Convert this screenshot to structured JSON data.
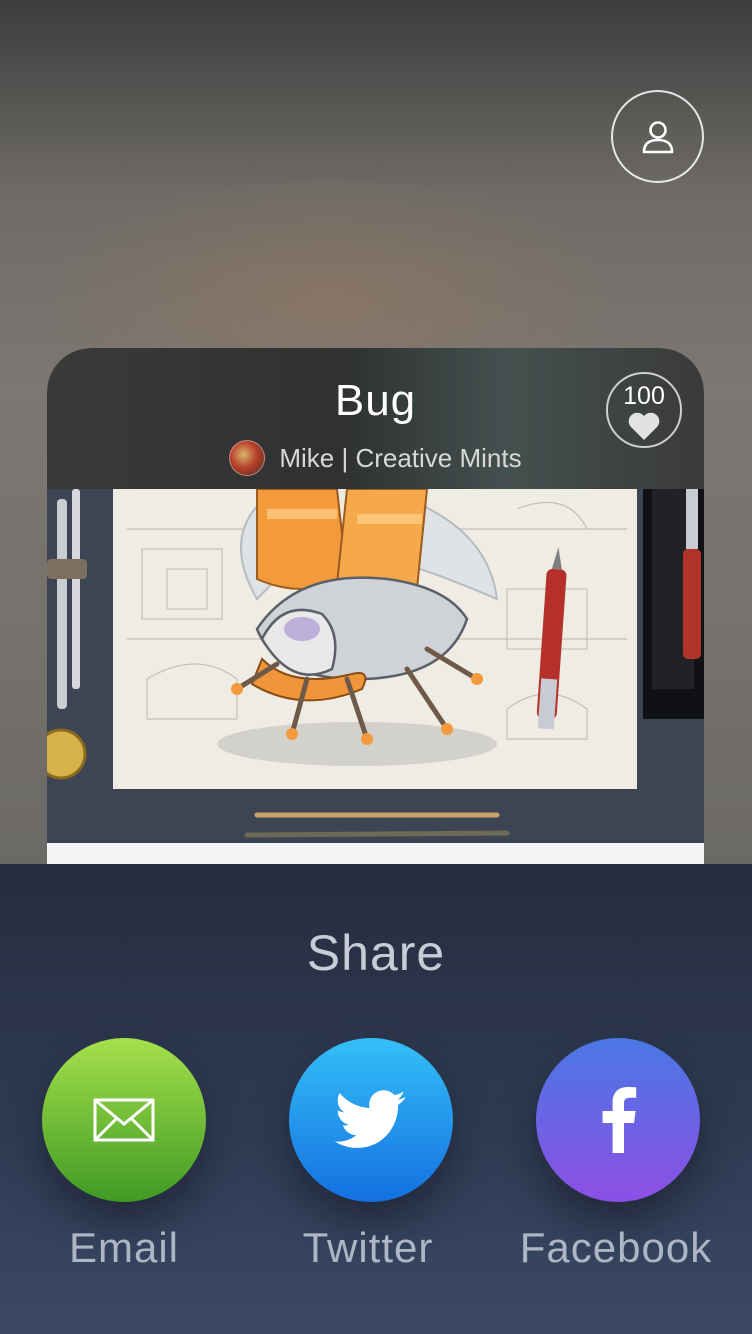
{
  "profile": {
    "icon": "user-icon"
  },
  "card": {
    "title": "Bug",
    "author": "Mike | Creative Mints",
    "likes": "100",
    "like_icon": "heart-icon"
  },
  "share": {
    "title": "Share",
    "options": [
      {
        "label": "Email",
        "icon": "envelope-icon",
        "color": "#5fb832"
      },
      {
        "label": "Twitter",
        "icon": "twitter-bird-icon",
        "color": "#1e90ef"
      },
      {
        "label": "Facebook",
        "icon": "facebook-f-icon",
        "color": "#6b62e6"
      }
    ]
  }
}
